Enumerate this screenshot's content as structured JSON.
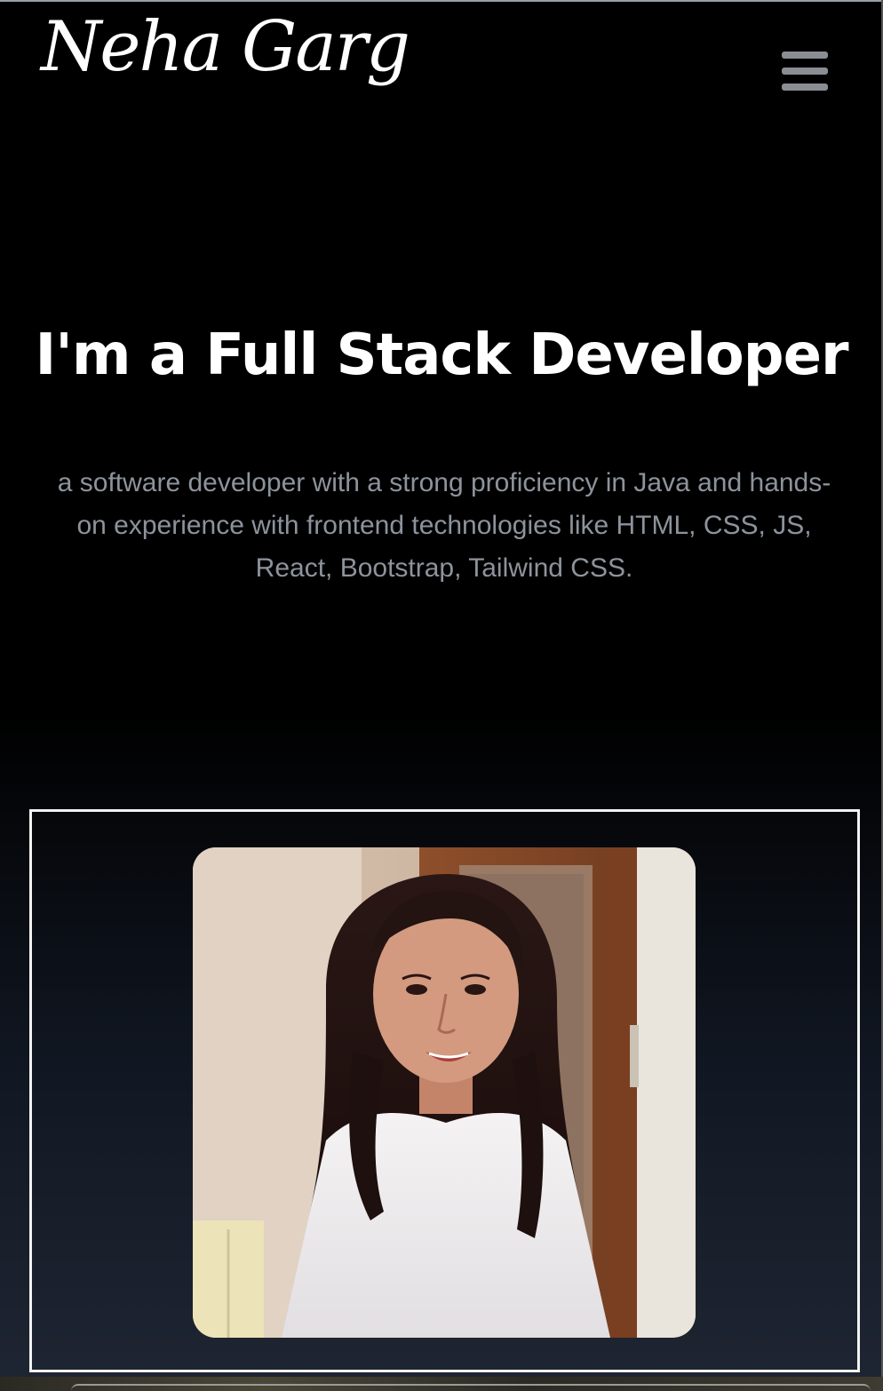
{
  "header": {
    "logo_text": "Neha Garg",
    "menu_icon": "hamburger-menu-icon"
  },
  "hero": {
    "title": "I'm a Full Stack Developer",
    "description": "a software developer with a strong proficiency in Java and hands-on experience with frontend technologies like HTML, CSS, JS, React, Bootstrap, Tailwind CSS."
  },
  "colors": {
    "background": "#000000",
    "title": "#ffffff",
    "description": "#8d939c",
    "menu_icon": "#8a8d93",
    "frame_border": "#f2f2f2"
  }
}
